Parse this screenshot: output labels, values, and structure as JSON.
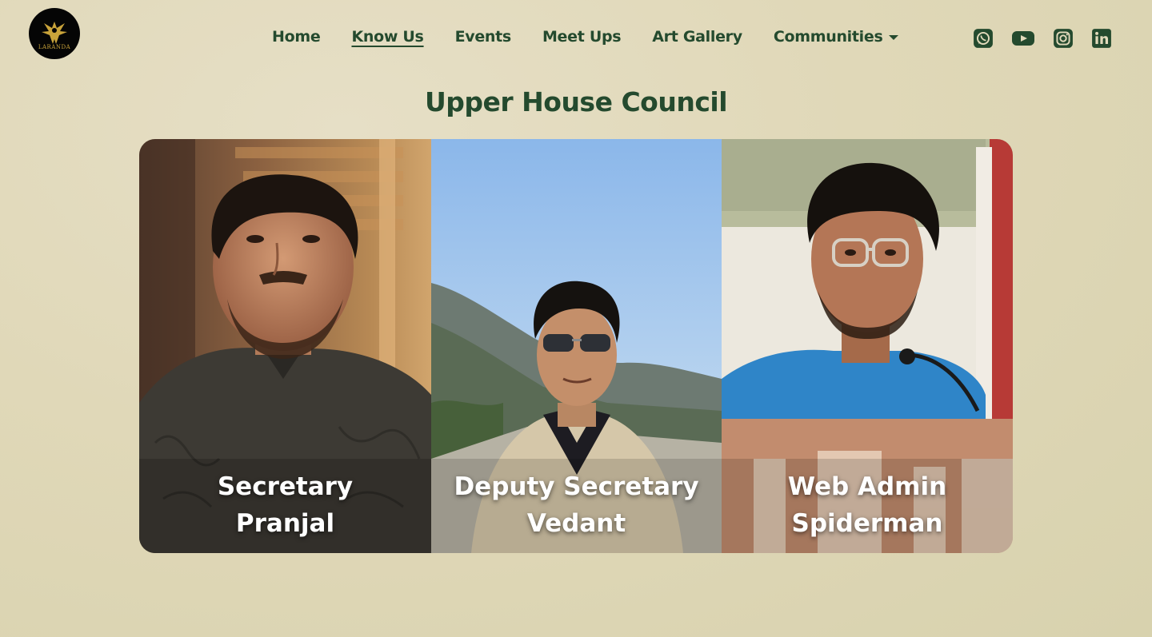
{
  "brand": {
    "logo_text": "LARANDA"
  },
  "nav": {
    "links": [
      {
        "label": "Home",
        "active": false
      },
      {
        "label": "Know Us",
        "active": true
      },
      {
        "label": "Events",
        "active": false
      },
      {
        "label": "Meet Ups",
        "active": false
      },
      {
        "label": "Art Gallery",
        "active": false
      },
      {
        "label": "Communities",
        "active": false
      }
    ]
  },
  "socials": [
    "whatsapp-icon",
    "youtube-icon",
    "instagram-icon",
    "linkedin-icon"
  ],
  "page_title": "Upper House Council",
  "members": [
    {
      "role": "Secretary",
      "name": "Pranjal"
    },
    {
      "role": "Deputy Secretary",
      "name": "Vedant"
    },
    {
      "role": "Web Admin",
      "name": "Spiderman"
    }
  ],
  "colors": {
    "accent": "#244a2e",
    "background": "#e2dabb",
    "logo_gold": "#c9a33a"
  }
}
